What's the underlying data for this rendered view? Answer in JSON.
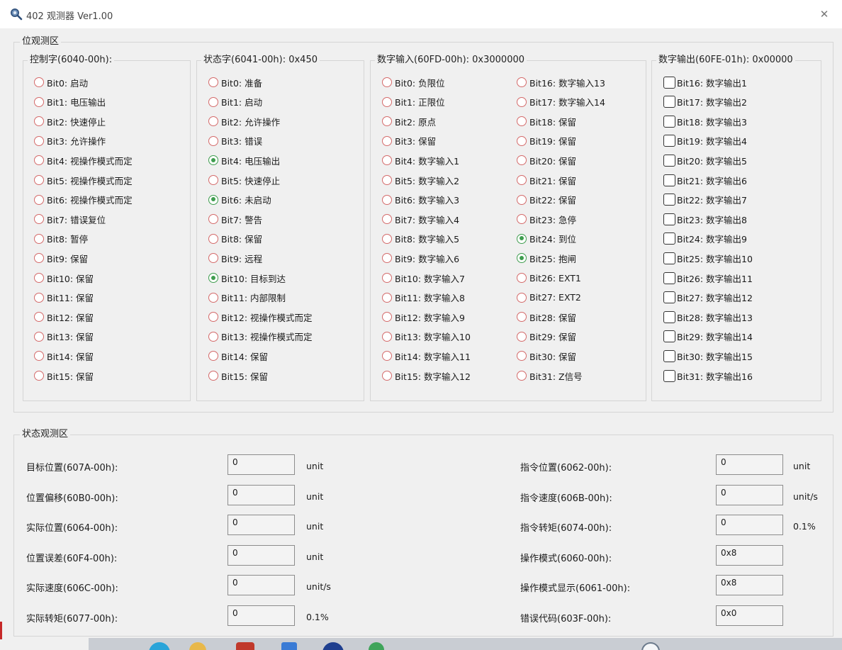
{
  "window": {
    "title": "402 观测器 Ver1.00",
    "close_glyph": "✕",
    "icon": "magnifier-icon"
  },
  "bit_area": {
    "title": "位观测区",
    "control_word": {
      "title": "控制字(6040-00h):",
      "bits": [
        {
          "label": "Bit0: 启动",
          "on": false
        },
        {
          "label": "Bit1: 电压输出",
          "on": false
        },
        {
          "label": "Bit2: 快速停止",
          "on": false
        },
        {
          "label": "Bit3: 允许操作",
          "on": false
        },
        {
          "label": "Bit4: 视操作模式而定",
          "on": false
        },
        {
          "label": "Bit5: 视操作模式而定",
          "on": false
        },
        {
          "label": "Bit6: 视操作模式而定",
          "on": false
        },
        {
          "label": "Bit7: 错误复位",
          "on": false
        },
        {
          "label": "Bit8: 暂停",
          "on": false
        },
        {
          "label": "Bit9: 保留",
          "on": false
        },
        {
          "label": "Bit10: 保留",
          "on": false
        },
        {
          "label": "Bit11: 保留",
          "on": false
        },
        {
          "label": "Bit12: 保留",
          "on": false
        },
        {
          "label": "Bit13: 保留",
          "on": false
        },
        {
          "label": "Bit14: 保留",
          "on": false
        },
        {
          "label": "Bit15: 保留",
          "on": false
        }
      ]
    },
    "status_word": {
      "title": "状态字(6041-00h): 0x450",
      "bits": [
        {
          "label": "Bit0: 准备",
          "on": false
        },
        {
          "label": "Bit1: 启动",
          "on": false
        },
        {
          "label": "Bit2: 允许操作",
          "on": false
        },
        {
          "label": "Bit3: 错误",
          "on": false
        },
        {
          "label": "Bit4: 电压输出",
          "on": true
        },
        {
          "label": "Bit5: 快速停止",
          "on": false
        },
        {
          "label": "Bit6: 未启动",
          "on": true
        },
        {
          "label": "Bit7: 警告",
          "on": false
        },
        {
          "label": "Bit8: 保留",
          "on": false
        },
        {
          "label": "Bit9: 远程",
          "on": false
        },
        {
          "label": "Bit10: 目标到达",
          "on": true
        },
        {
          "label": "Bit11: 内部限制",
          "on": false
        },
        {
          "label": "Bit12: 视操作模式而定",
          "on": false
        },
        {
          "label": "Bit13: 视操作模式而定",
          "on": false
        },
        {
          "label": "Bit14: 保留",
          "on": false
        },
        {
          "label": "Bit15: 保留",
          "on": false
        }
      ]
    },
    "digital_input": {
      "title": "数字输入(60FD-00h): 0x3000000",
      "bits_left": [
        {
          "label": "Bit0: 负限位",
          "on": false
        },
        {
          "label": "Bit1: 正限位",
          "on": false
        },
        {
          "label": "Bit2: 原点",
          "on": false
        },
        {
          "label": "Bit3: 保留",
          "on": false
        },
        {
          "label": "Bit4: 数字输入1",
          "on": false
        },
        {
          "label": "Bit5: 数字输入2",
          "on": false
        },
        {
          "label": "Bit6: 数字输入3",
          "on": false
        },
        {
          "label": "Bit7: 数字输入4",
          "on": false
        },
        {
          "label": "Bit8: 数字输入5",
          "on": false
        },
        {
          "label": "Bit9: 数字输入6",
          "on": false
        },
        {
          "label": "Bit10: 数字输入7",
          "on": false
        },
        {
          "label": "Bit11: 数字输入8",
          "on": false
        },
        {
          "label": "Bit12: 数字输入9",
          "on": false
        },
        {
          "label": "Bit13: 数字输入10",
          "on": false
        },
        {
          "label": "Bit14: 数字输入11",
          "on": false
        },
        {
          "label": "Bit15: 数字输入12",
          "on": false
        }
      ],
      "bits_right": [
        {
          "label": "Bit16: 数字输入13",
          "on": false
        },
        {
          "label": "Bit17: 数字输入14",
          "on": false
        },
        {
          "label": "Bit18: 保留",
          "on": false
        },
        {
          "label": "Bit19: 保留",
          "on": false
        },
        {
          "label": "Bit20: 保留",
          "on": false
        },
        {
          "label": "Bit21: 保留",
          "on": false
        },
        {
          "label": "Bit22: 保留",
          "on": false
        },
        {
          "label": "Bit23: 急停",
          "on": false
        },
        {
          "label": "Bit24: 到位",
          "on": true
        },
        {
          "label": "Bit25: 抱闸",
          "on": true
        },
        {
          "label": "Bit26: EXT1",
          "on": false
        },
        {
          "label": "Bit27: EXT2",
          "on": false
        },
        {
          "label": "Bit28: 保留",
          "on": false
        },
        {
          "label": "Bit29: 保留",
          "on": false
        },
        {
          "label": "Bit30: 保留",
          "on": false
        },
        {
          "label": "Bit31: Z信号",
          "on": false
        }
      ]
    },
    "digital_output": {
      "title": "数字输出(60FE-01h): 0x00000",
      "bits": [
        {
          "label": "Bit16: 数字输出1",
          "checked": false
        },
        {
          "label": "Bit17: 数字输出2",
          "checked": false
        },
        {
          "label": "Bit18: 数字输出3",
          "checked": false
        },
        {
          "label": "Bit19: 数字输出4",
          "checked": false
        },
        {
          "label": "Bit20: 数字输出5",
          "checked": false
        },
        {
          "label": "Bit21: 数字输出6",
          "checked": false
        },
        {
          "label": "Bit22: 数字输出7",
          "checked": false
        },
        {
          "label": "Bit23: 数字输出8",
          "checked": false
        },
        {
          "label": "Bit24: 数字输出9",
          "checked": false
        },
        {
          "label": "Bit25: 数字输出10",
          "checked": false
        },
        {
          "label": "Bit26: 数字输出11",
          "checked": false
        },
        {
          "label": "Bit27: 数字输出12",
          "checked": false
        },
        {
          "label": "Bit28: 数字输出13",
          "checked": false
        },
        {
          "label": "Bit29: 数字输出14",
          "checked": false
        },
        {
          "label": "Bit30: 数字输出15",
          "checked": false
        },
        {
          "label": "Bit31: 数字输出16",
          "checked": false
        }
      ]
    }
  },
  "status_area": {
    "title": "状态观测区",
    "left_fields": [
      {
        "label": "目标位置(607A-00h):",
        "value": "0",
        "unit": "unit"
      },
      {
        "label": "位置偏移(60B0-00h):",
        "value": "0",
        "unit": "unit"
      },
      {
        "label": "实际位置(6064-00h):",
        "value": "0",
        "unit": "unit"
      },
      {
        "label": "位置误差(60F4-00h):",
        "value": "0",
        "unit": "unit"
      },
      {
        "label": "实际速度(606C-00h):",
        "value": "0",
        "unit": "unit/s"
      },
      {
        "label": "实际转矩(6077-00h):",
        "value": "0",
        "unit": "0.1%"
      }
    ],
    "right_fields": [
      {
        "label": "指令位置(6062-00h):",
        "value": "0",
        "unit": "unit"
      },
      {
        "label": "指令速度(606B-00h):",
        "value": "0",
        "unit": "unit/s"
      },
      {
        "label": "指令转矩(6074-00h):",
        "value": "0",
        "unit": "0.1%"
      },
      {
        "label": "操作模式(6060-00h):",
        "value": "0x8",
        "unit": ""
      },
      {
        "label": "操作模式显示(6061-00h):",
        "value": "0x8",
        "unit": ""
      },
      {
        "label": "错误代码(603F-00h):",
        "value": "0x0",
        "unit": ""
      }
    ]
  },
  "taskbar": {
    "icons": [
      "app-icon-1",
      "app-icon-2",
      "app-icon-3",
      "app-icon-4",
      "app-icon-5",
      "app-icon-6",
      "app-icon-7"
    ]
  }
}
